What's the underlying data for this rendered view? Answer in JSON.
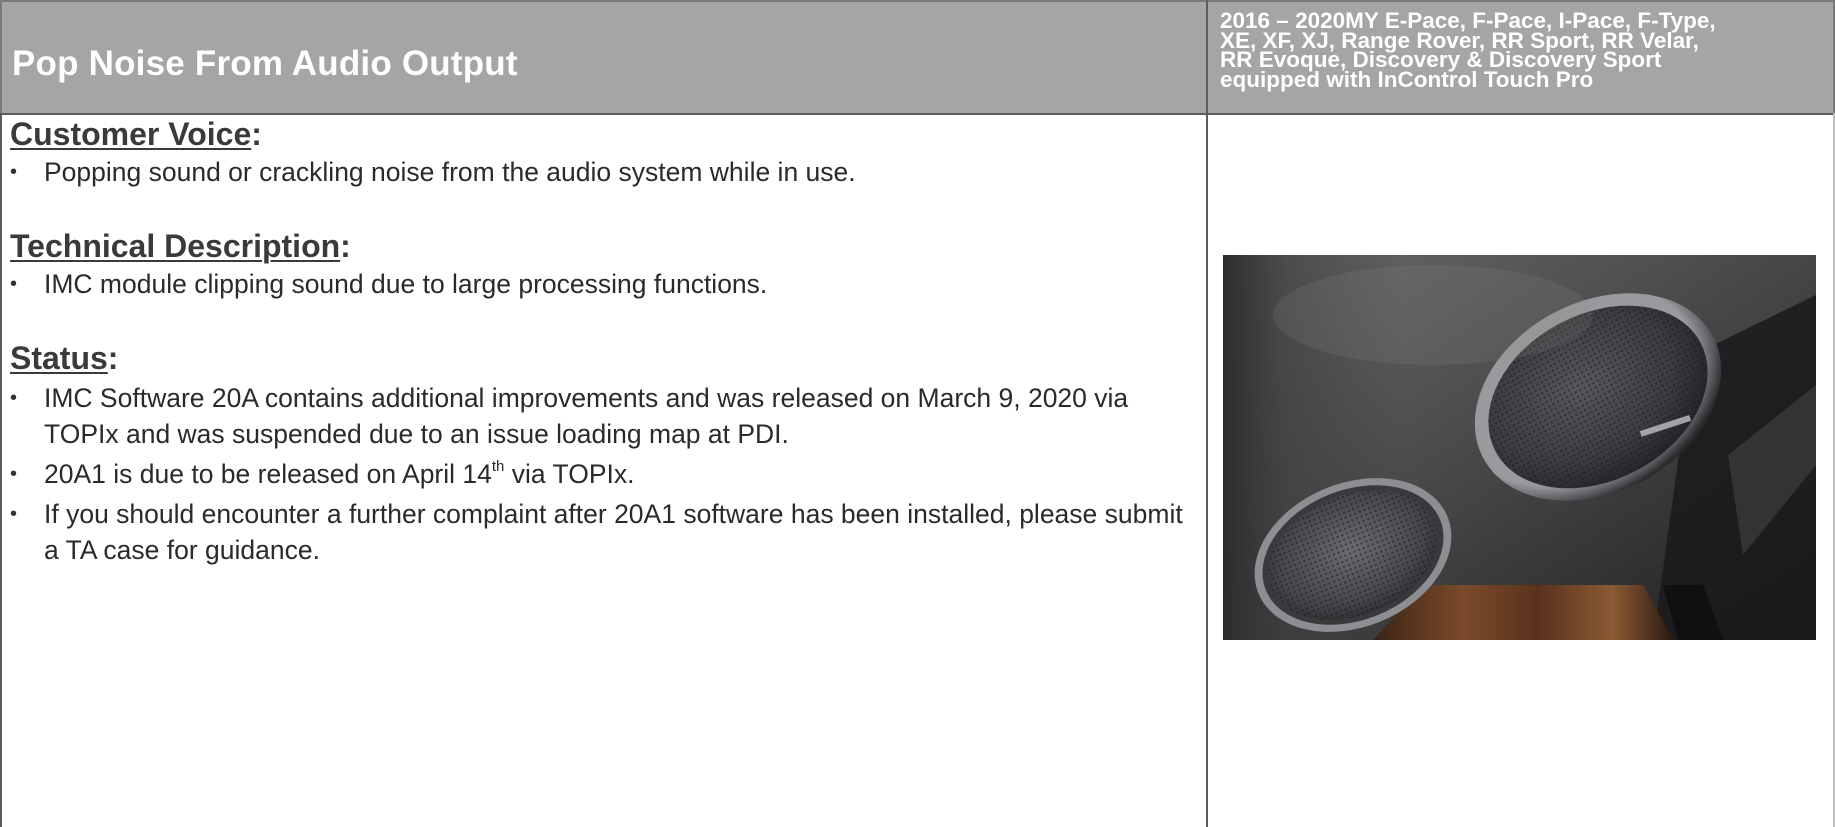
{
  "document": {
    "title": "Pop Noise From Audio Output",
    "applicability": "2016 – 2020MY E-Pace, F-Pace, I-Pace, F-Type,\nXE, XF, XJ, Range Rover, RR Sport, RR Velar,\nRR Evoque, Discovery & Discovery Sport\nequipped with InControl Touch Pro"
  },
  "customer_voice": {
    "heading": "Customer Voice",
    "colon": ":",
    "items": [
      "Popping sound or crackling noise from the audio system while in use."
    ]
  },
  "technical_description": {
    "heading": "Technical Description",
    "colon": ":",
    "items": [
      "IMC module clipping sound due to large processing functions."
    ]
  },
  "status": {
    "heading": "Status",
    "colon": ":",
    "item1": "IMC Software 20A contains additional improvements and was released on March 9, 2020 via TOPIx and was suspended due to an issue loading map at PDI.",
    "item2_before": "20A1 is due to be released on April 14",
    "item2_sup": "th",
    "item2_after": " via TOPIx.",
    "item3": "If you should encounter a further complaint after 20A1 software has been installed, please submit a TA case for guidance."
  },
  "image": {
    "subject": "speaker-grilles-photo"
  }
}
